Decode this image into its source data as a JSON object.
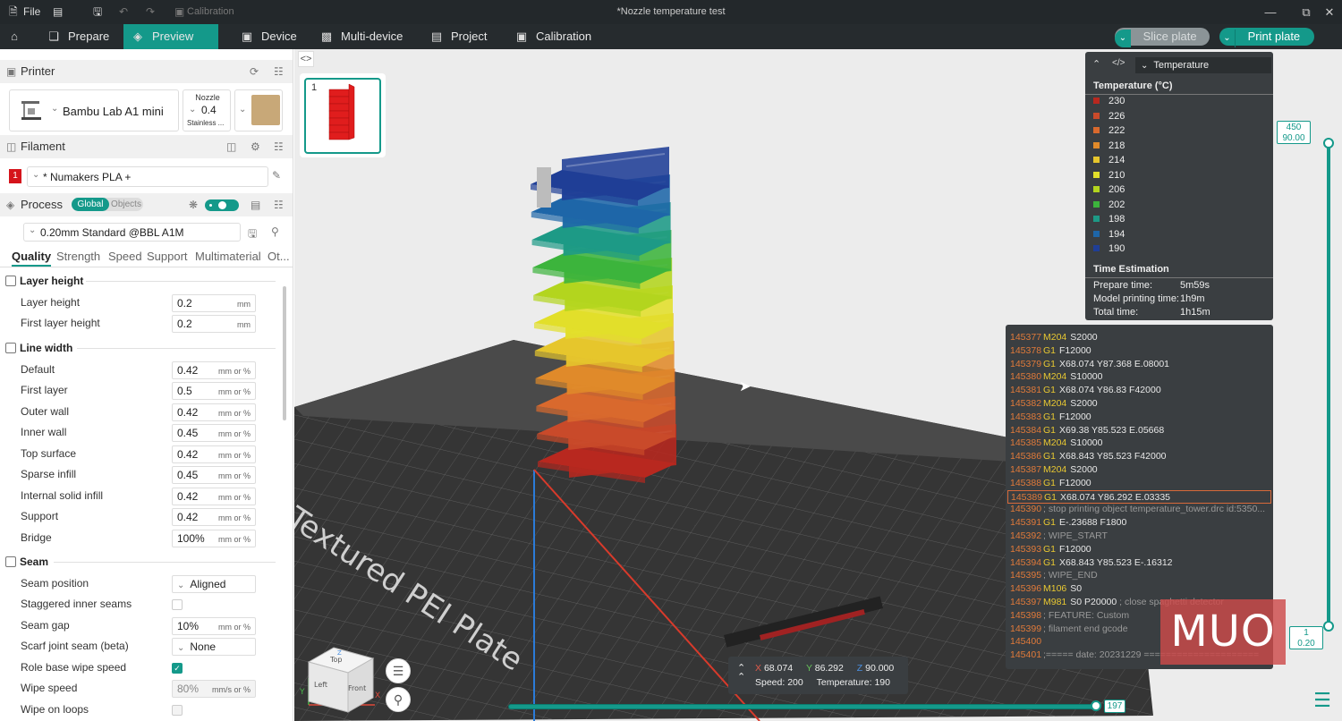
{
  "titlebar": {
    "file_label": "File",
    "calibration_label": "Calibration",
    "window_title": "*Nozzle temperature test"
  },
  "nav": {
    "prepare": "Prepare",
    "preview": "Preview",
    "device": "Device",
    "multi_device": "Multi-device",
    "project": "Project",
    "calibration": "Calibration",
    "slice_plate": "Slice plate",
    "print_plate": "Print plate"
  },
  "printer": {
    "section_title": "Printer",
    "name": "Bambu Lab A1 mini",
    "nozzle_label": "Nozzle",
    "nozzle_value": "0.4",
    "nozzle_type": "Stainless ..."
  },
  "filament": {
    "section_title": "Filament",
    "slot_number": "1",
    "name": "* Numakers PLA +"
  },
  "process": {
    "section_title": "Process",
    "toggle_global": "Global",
    "toggle_objects": "Objects",
    "preset": "0.20mm Standard @BBL A1M",
    "tabs": [
      "Quality",
      "Strength",
      "Speed",
      "Support",
      "Multimaterial",
      "Ot..."
    ]
  },
  "groups": {
    "layer_height": "Layer height",
    "line_width": "Line width",
    "seam": "Seam"
  },
  "params": {
    "layer_height": {
      "label": "Layer height",
      "value": "0.2",
      "unit": "mm"
    },
    "first_layer_height": {
      "label": "First layer height",
      "value": "0.2",
      "unit": "mm"
    },
    "default": {
      "label": "Default",
      "value": "0.42",
      "unit": "mm or %"
    },
    "first_layer": {
      "label": "First layer",
      "value": "0.5",
      "unit": "mm or %"
    },
    "outer_wall": {
      "label": "Outer wall",
      "value": "0.42",
      "unit": "mm or %"
    },
    "inner_wall": {
      "label": "Inner wall",
      "value": "0.45",
      "unit": "mm or %"
    },
    "top_surface": {
      "label": "Top surface",
      "value": "0.42",
      "unit": "mm or %"
    },
    "sparse_infill": {
      "label": "Sparse infill",
      "value": "0.45",
      "unit": "mm or %"
    },
    "internal_solid_infill": {
      "label": "Internal solid infill",
      "value": "0.42",
      "unit": "mm or %"
    },
    "support": {
      "label": "Support",
      "value": "0.42",
      "unit": "mm or %"
    },
    "bridge": {
      "label": "Bridge",
      "value": "100%",
      "unit": "mm or %"
    },
    "seam_position": {
      "label": "Seam position",
      "value": "Aligned"
    },
    "staggered_inner_seams": {
      "label": "Staggered inner seams"
    },
    "seam_gap": {
      "label": "Seam gap",
      "value": "10%",
      "unit": "mm or %"
    },
    "scarf_joint_seam": {
      "label": "Scarf joint seam (beta)",
      "value": "None"
    },
    "role_base_wipe_speed": {
      "label": "Role base wipe speed"
    },
    "wipe_speed": {
      "label": "Wipe speed",
      "value": "80%",
      "unit": "mm/s or %"
    },
    "wipe_on_loops": {
      "label": "Wipe on loops"
    }
  },
  "thumbnail": {
    "plate_number": "1"
  },
  "legend": {
    "dropdown_value": "Temperature",
    "temperature_title": "Temperature (°C)",
    "items": [
      {
        "label": "230",
        "color": "#b8281f"
      },
      {
        "label": "226",
        "color": "#c94a2a"
      },
      {
        "label": "222",
        "color": "#d9692d"
      },
      {
        "label": "218",
        "color": "#e08a2a"
      },
      {
        "label": "214",
        "color": "#e6c62c"
      },
      {
        "label": "210",
        "color": "#e2df2a"
      },
      {
        "label": "206",
        "color": "#b3d51e"
      },
      {
        "label": "202",
        "color": "#3cb43c"
      },
      {
        "label": "198",
        "color": "#1d9a86"
      },
      {
        "label": "194",
        "color": "#1e66a8"
      },
      {
        "label": "190",
        "color": "#1f3e96"
      }
    ],
    "time_title": "Time Estimation",
    "prepare_label": "Prepare time:",
    "prepare_value": "5m59s",
    "model_label": "Model printing time:",
    "model_value": "1h9m",
    "total_label": "Total time:",
    "total_value": "1h15m"
  },
  "gcode": [
    {
      "n": "145377",
      "k": "M204",
      "a": "S2000"
    },
    {
      "n": "145378",
      "k": "G1",
      "a": "F12000"
    },
    {
      "n": "145379",
      "k": "G1",
      "a": "X68.074 Y87.368 E.08001"
    },
    {
      "n": "145380",
      "k": "M204",
      "a": "S10000"
    },
    {
      "n": "145381",
      "k": "G1",
      "a": "X68.074 Y86.83 F42000"
    },
    {
      "n": "145382",
      "k": "M204",
      "a": "S2000"
    },
    {
      "n": "145383",
      "k": "G1",
      "a": "F12000"
    },
    {
      "n": "145384",
      "k": "G1",
      "a": "X69.38 Y85.523 E.05668"
    },
    {
      "n": "145385",
      "k": "M204",
      "a": "S10000"
    },
    {
      "n": "145386",
      "k": "G1",
      "a": "X68.843 Y85.523 F42000"
    },
    {
      "n": "145387",
      "k": "M204",
      "a": "S2000"
    },
    {
      "n": "145388",
      "k": "G1",
      "a": "F12000"
    },
    {
      "n": "145389",
      "k": "G1",
      "a": "X68.074 Y86.292 E.03335",
      "selected": true
    },
    {
      "n": "145390",
      "c": "; stop printing object temperature_tower.drc id:5350..."
    },
    {
      "n": "145391",
      "k": "G1",
      "a": "E-.23688 F1800"
    },
    {
      "n": "145392",
      "c": "; WIPE_START"
    },
    {
      "n": "145393",
      "k": "G1",
      "a": "F12000"
    },
    {
      "n": "145394",
      "k": "G1",
      "a": "X68.843 Y85.523 E-.16312"
    },
    {
      "n": "145395",
      "c": "; WIPE_END"
    },
    {
      "n": "145396",
      "k": "M106",
      "a": "S0"
    },
    {
      "n": "145397",
      "k": "M981",
      "a": "S0 P20000",
      "c": "; close spaghetti detector"
    },
    {
      "n": "145398",
      "c": "; FEATURE: Custom"
    },
    {
      "n": "145399",
      "c": "; filament end gcode"
    },
    {
      "n": "145400",
      "c": ""
    },
    {
      "n": "145401",
      "c": ";===== date: 20231229 ====================="
    }
  ],
  "position": {
    "x_label": "X",
    "x_value": "68.074",
    "y_label": "Y",
    "y_value": "86.292",
    "z_label": "Z",
    "z_value": "90.000",
    "speed_label": "Speed:",
    "speed_value": "200",
    "temp_label": "Temperature:",
    "temp_value": "190"
  },
  "vslider": {
    "top_layer": "450",
    "top_height": "90.00",
    "bottom_layer": "1",
    "bottom_height": "0.20"
  },
  "hslider": {
    "value": "197"
  },
  "bed": {
    "label": "Textured PEI Plate"
  },
  "cube": {
    "top": "Top",
    "left": "Left",
    "front": "Front",
    "axis_x": "X",
    "axis_y": "Y",
    "axis_z": "Z"
  },
  "watermark": "MUO"
}
